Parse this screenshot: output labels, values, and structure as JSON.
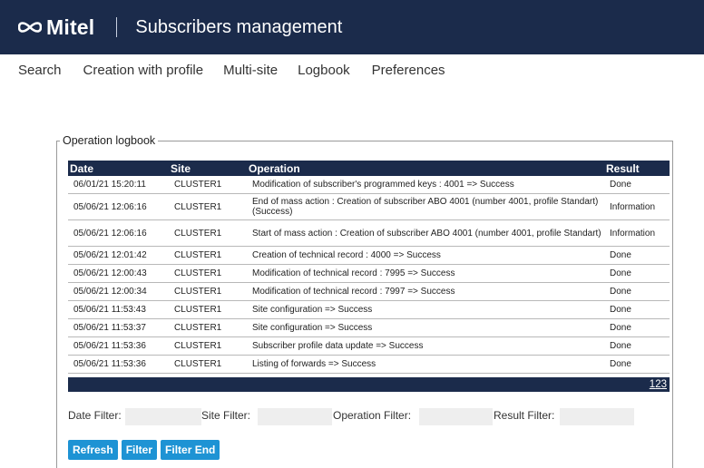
{
  "header": {
    "logo_text": "Mitel",
    "title": "Subscribers management"
  },
  "nav": [
    "Search",
    "Creation with profile",
    "Multi-site",
    "Logbook",
    "Preferences"
  ],
  "logbook": {
    "legend": "Operation logbook",
    "columns": [
      "Date",
      "Site",
      "Operation",
      "Result"
    ],
    "rows": [
      {
        "date": "06/01/21 15:20:11",
        "site": "CLUSTER1",
        "operation": "Modification of subscriber's programmed keys : 4001 => Success",
        "result": "Done"
      },
      {
        "date": "05/06/21 12:06:16",
        "site": "CLUSTER1",
        "operation": "End of mass action : Creation of subscriber ABO 4001 (number 4001, profile Standart) (Success)",
        "result": "Information"
      },
      {
        "date": "05/06/21 12:06:16",
        "site": "CLUSTER1",
        "operation": "Start of mass action : Creation of subscriber ABO 4001 (number 4001, profile Standart)",
        "result": "Information"
      },
      {
        "date": "05/06/21 12:01:42",
        "site": "CLUSTER1",
        "operation": "Creation of technical record : 4000 => Success",
        "result": "Done"
      },
      {
        "date": "05/06/21 12:00:43",
        "site": "CLUSTER1",
        "operation": "Modification of technical record : 7995 => Success",
        "result": "Done"
      },
      {
        "date": "05/06/21 12:00:34",
        "site": "CLUSTER1",
        "operation": "Modification of technical record : 7997 => Success",
        "result": "Done"
      },
      {
        "date": "05/06/21 11:53:43",
        "site": "CLUSTER1",
        "operation": "Site configuration => Success",
        "result": "Done"
      },
      {
        "date": "05/06/21 11:53:37",
        "site": "CLUSTER1",
        "operation": "Site configuration => Success",
        "result": "Done"
      },
      {
        "date": "05/06/21 11:53:36",
        "site": "CLUSTER1",
        "operation": "Subscriber profile data update => Success",
        "result": "Done"
      },
      {
        "date": "05/06/21 11:53:36",
        "site": "CLUSTER1",
        "operation": "Listing of forwards => Success",
        "result": "Done"
      }
    ],
    "pages": [
      "1",
      "2",
      "3"
    ]
  },
  "filters": {
    "date_label": "Date Filter:",
    "date_value": "",
    "site_label": "Site Filter:",
    "site_value": "",
    "operation_label": "Operation Filter:",
    "operation_value": "",
    "result_label": "Result Filter:",
    "result_value": ""
  },
  "buttons": {
    "refresh": "Refresh",
    "filter": "Filter",
    "filter_end": "Filter End"
  },
  "colors": {
    "header_bg": "#1b2b4b",
    "button_bg": "#1e93d4"
  },
  "icons": {
    "logo": "mitel-logo-icon"
  }
}
